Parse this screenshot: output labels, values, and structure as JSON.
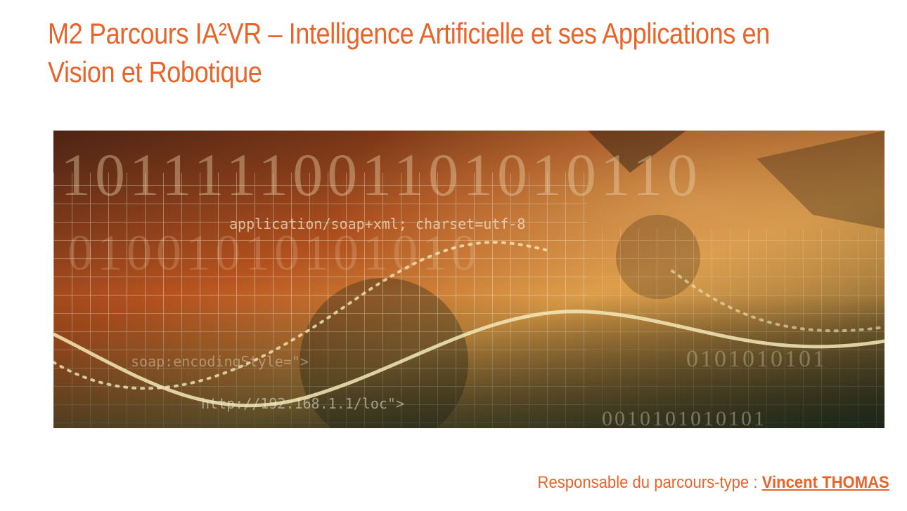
{
  "page": {
    "title": "M2 Parcours IA²VR – Intelligence Artificielle et ses Applications en Vision et Robotique"
  },
  "banner": {
    "image_name": "banner-image",
    "overlay_text": {
      "binary_top": "1011111001101010110",
      "code_line_1": "application/soap+xml; charset=utf-8",
      "binary_mid": "01001010101010",
      "code_line_2": "soap:encodingStyle=\">",
      "code_line_3": "http://192.168.1.1/loc\">",
      "binary_right": "0101010101",
      "binary_bottom": "0010101010101"
    },
    "colors": {
      "top": "#8a3a18",
      "mid": "#c88438",
      "bottom": "#2d3a2a"
    }
  },
  "responsible": {
    "label": "Responsable du parcours-type :",
    "name": "Vincent THOMAS"
  },
  "accent_color": "#e8642b"
}
